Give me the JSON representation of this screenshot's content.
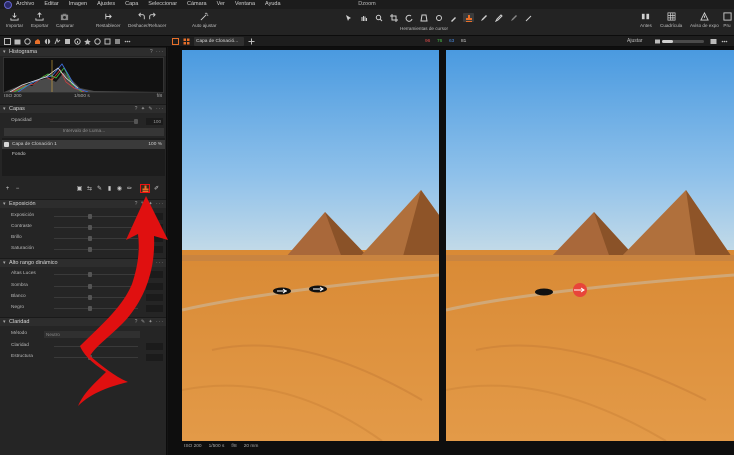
{
  "menu": {
    "items": [
      "Archivo",
      "Editar",
      "Imagen",
      "Ajustes",
      "Capa",
      "Seleccionar",
      "Cámara",
      "Ver",
      "Ventana",
      "Ayuda"
    ],
    "window_title": "Dzoom"
  },
  "toolbar": {
    "left": [
      {
        "label": "Importar",
        "icon": "import-icon"
      },
      {
        "label": "Exportar",
        "icon": "export-icon"
      },
      {
        "label": "Capturar",
        "icon": "camera-icon"
      }
    ],
    "middle": [
      {
        "label": "Restablecer",
        "icon": "reset-icon"
      },
      {
        "label": "Deshacer/Rehacer",
        "icon": "undo-redo-icon"
      },
      {
        "label": "Auto ajustar",
        "icon": "auto-adjust-icon"
      }
    ],
    "cursor_tools_label": "Herramientas de cursor",
    "right": [
      {
        "label": "Antes",
        "icon": "before-after-icon"
      },
      {
        "label": "Cuadrícula",
        "icon": "grid-icon"
      },
      {
        "label": "Aviso de expo",
        "icon": "exposure-warning-icon"
      },
      {
        "label": "Pru",
        "icon": "proof-icon"
      }
    ]
  },
  "tabrow": {
    "viewer_tab": "Capa de Clonació...",
    "rgb": {
      "r": "96",
      "g": "76",
      "b": "63",
      "l": "81"
    },
    "ajustar_label": "Ajustar",
    "zoom_fraction": 0.25
  },
  "histogram": {
    "title": "Histograma",
    "iso": "ISO 200",
    "shutter": "1/500 s",
    "aperture": "f/8"
  },
  "layers": {
    "title": "Capas",
    "opacity_label": "Opacidad",
    "opacity_value": "100",
    "luma_button": "Intervalo de Luma...",
    "rows": [
      {
        "name": "Capa de Clonación 1",
        "value": "100 %"
      },
      {
        "name": "Fondo",
        "value": ""
      }
    ]
  },
  "exposure": {
    "title": "Exposición",
    "sliders": [
      {
        "label": "Exposición",
        "value": ""
      },
      {
        "label": "Contraste",
        "value": ""
      },
      {
        "label": "Brillo",
        "value": ""
      },
      {
        "label": "Saturación",
        "value": ""
      }
    ]
  },
  "hdr": {
    "title": "Alto rango dinámico",
    "sliders": [
      {
        "label": "Altas Luces",
        "value": ""
      },
      {
        "label": "Sombra",
        "value": ""
      },
      {
        "label": "Blanco",
        "value": ""
      },
      {
        "label": "Negro",
        "value": ""
      }
    ]
  },
  "clarity": {
    "title": "Claridad",
    "method_label": "Método",
    "method_value": "Neutro",
    "sliders": [
      {
        "label": "Claridad",
        "value": ""
      },
      {
        "label": "Estructura",
        "value": ""
      }
    ]
  },
  "viewer": {
    "iso": "ISO 200",
    "shutter": "1/500 s",
    "aperture": "f/8",
    "focal": "20 mm"
  },
  "colors": {
    "accent": "#e8702a",
    "highlight_red": "#e01010",
    "sky_top": "#4a9ae0",
    "sand": "#d98a35"
  }
}
